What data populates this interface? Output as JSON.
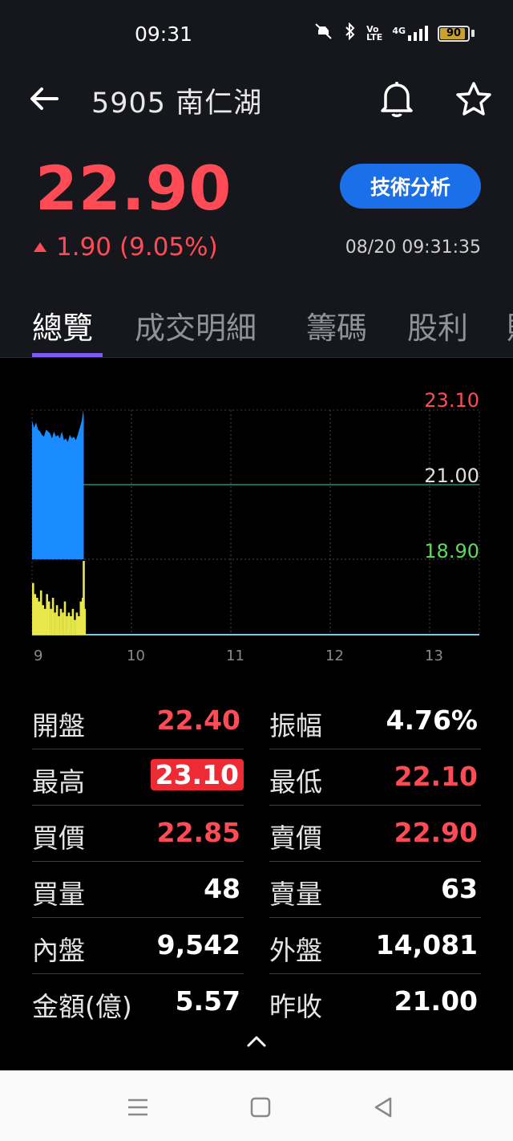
{
  "status_bar": {
    "time": "09:31",
    "network": "4G",
    "battery": "90"
  },
  "header": {
    "title": "5905 南仁湖"
  },
  "quote": {
    "price": "22.90",
    "change": "1.90",
    "change_pct": "(9.05%)",
    "timestamp": "08/20 09:31:35",
    "tech_button": "技術分析"
  },
  "tabs": [
    {
      "label": "總覽",
      "active": true
    },
    {
      "label": "成交明細",
      "active": false
    },
    {
      "label": "籌碼",
      "active": false
    },
    {
      "label": "股利",
      "active": false
    },
    {
      "label": "財",
      "active": false
    }
  ],
  "chart_data": {
    "type": "area",
    "x_ticks": [
      "9",
      "10",
      "11",
      "12",
      "13"
    ],
    "price_labels": {
      "high": "23.10",
      "ref": "21.00",
      "low": "18.90"
    },
    "ylim": [
      18.9,
      23.1
    ],
    "x_range_hours": [
      9,
      13.5
    ],
    "price_series_color": "#1a8cff",
    "volume_series_color": "#e8e84a",
    "price": [
      [
        9.0,
        22.8
      ],
      [
        9.02,
        22.6
      ],
      [
        9.04,
        22.75
      ],
      [
        9.06,
        22.55
      ],
      [
        9.08,
        22.5
      ],
      [
        9.1,
        22.4
      ],
      [
        9.12,
        22.35
      ],
      [
        9.14,
        22.55
      ],
      [
        9.16,
        22.5
      ],
      [
        9.18,
        22.45
      ],
      [
        9.2,
        22.3
      ],
      [
        9.22,
        22.5
      ],
      [
        9.24,
        22.35
      ],
      [
        9.26,
        22.4
      ],
      [
        9.28,
        22.3
      ],
      [
        9.3,
        22.5
      ],
      [
        9.32,
        22.25
      ],
      [
        9.34,
        22.3
      ],
      [
        9.36,
        22.2
      ],
      [
        9.38,
        22.4
      ],
      [
        9.4,
        22.3
      ],
      [
        9.42,
        22.35
      ],
      [
        9.44,
        22.25
      ],
      [
        9.46,
        22.4
      ],
      [
        9.48,
        22.6
      ],
      [
        9.5,
        22.8
      ],
      [
        9.515,
        23.1
      ],
      [
        9.52,
        22.9
      ]
    ],
    "volume": [
      [
        9.0,
        0.7
      ],
      [
        9.02,
        0.55
      ],
      [
        9.04,
        0.5
      ],
      [
        9.06,
        0.45
      ],
      [
        9.08,
        0.6
      ],
      [
        9.1,
        0.4
      ],
      [
        9.12,
        0.35
      ],
      [
        9.14,
        0.55
      ],
      [
        9.16,
        0.45
      ],
      [
        9.18,
        0.35
      ],
      [
        9.2,
        0.5
      ],
      [
        9.22,
        0.3
      ],
      [
        9.24,
        0.4
      ],
      [
        9.26,
        0.25
      ],
      [
        9.28,
        0.35
      ],
      [
        9.3,
        0.3
      ],
      [
        9.32,
        0.45
      ],
      [
        9.34,
        0.25
      ],
      [
        9.36,
        0.3
      ],
      [
        9.38,
        0.25
      ],
      [
        9.4,
        0.35
      ],
      [
        9.42,
        0.2
      ],
      [
        9.44,
        0.3
      ],
      [
        9.46,
        0.25
      ],
      [
        9.48,
        0.45
      ],
      [
        9.5,
        0.5
      ],
      [
        9.51,
        1.0
      ],
      [
        9.52,
        0.35
      ]
    ]
  },
  "stats": [
    [
      {
        "label": "開盤",
        "value": "22.40",
        "style": "red"
      },
      {
        "label": "振幅",
        "value": "4.76%",
        "style": "white"
      }
    ],
    [
      {
        "label": "最高",
        "value": "23.10",
        "style": "hl"
      },
      {
        "label": "最低",
        "value": "22.10",
        "style": "red"
      }
    ],
    [
      {
        "label": "買價",
        "value": "22.85",
        "style": "red"
      },
      {
        "label": "賣價",
        "value": "22.90",
        "style": "red"
      }
    ],
    [
      {
        "label": "買量",
        "value": "48",
        "style": "white"
      },
      {
        "label": "賣量",
        "value": "63",
        "style": "white"
      }
    ],
    [
      {
        "label": "內盤",
        "value": "9,542",
        "style": "white"
      },
      {
        "label": "外盤",
        "value": "14,081",
        "style": "white"
      }
    ],
    [
      {
        "label": "金額(億)",
        "value": "5.57",
        "style": "white"
      },
      {
        "label": "昨收",
        "value": "21.00",
        "style": "white"
      }
    ]
  ]
}
